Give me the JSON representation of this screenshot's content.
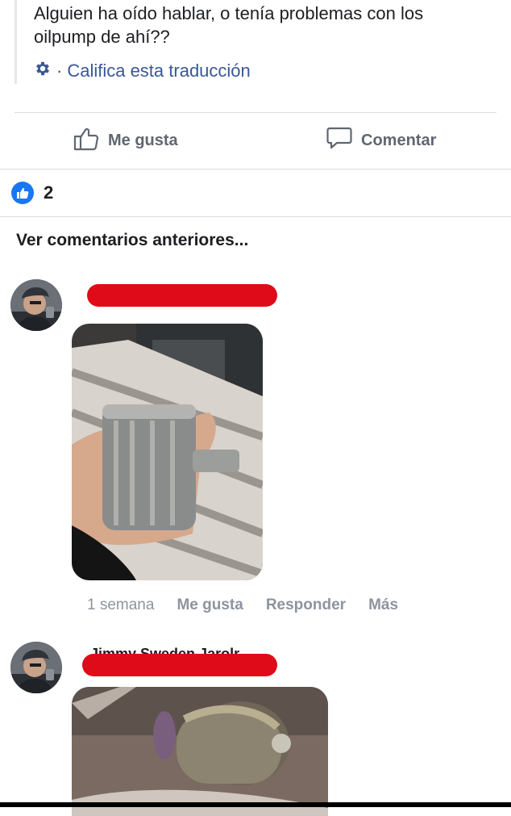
{
  "post": {
    "text": "Alguien ha oído hablar, o tenía problemas con los oilpump de ahí??",
    "translate_label": "Califica esta traducción",
    "translate_separator": "·",
    "translate_icon": "gear-icon"
  },
  "actions": {
    "like_label": "Me gusta",
    "like_icon": "thumbs-up-outline-icon",
    "comment_label": "Comentar",
    "comment_icon": "speech-bubble-icon"
  },
  "reactions": {
    "count": "2",
    "icon": "like-badge-icon",
    "accent_color": "#1877f2"
  },
  "comments": {
    "view_previous_label": "Ver comentarios anteriores...",
    "items": [
      {
        "author_redacted": true,
        "image": "piston-in-hand-photo",
        "time": "1 semana",
        "like_label": "Me gusta",
        "reply_label": "Responder",
        "more_label": "Más"
      },
      {
        "author_redacted": true,
        "author_visible_fragment": "Jimmy Sweden Jarolr",
        "image": "piston-closeup-photo"
      }
    ]
  },
  "redaction_color": "#e00b18"
}
